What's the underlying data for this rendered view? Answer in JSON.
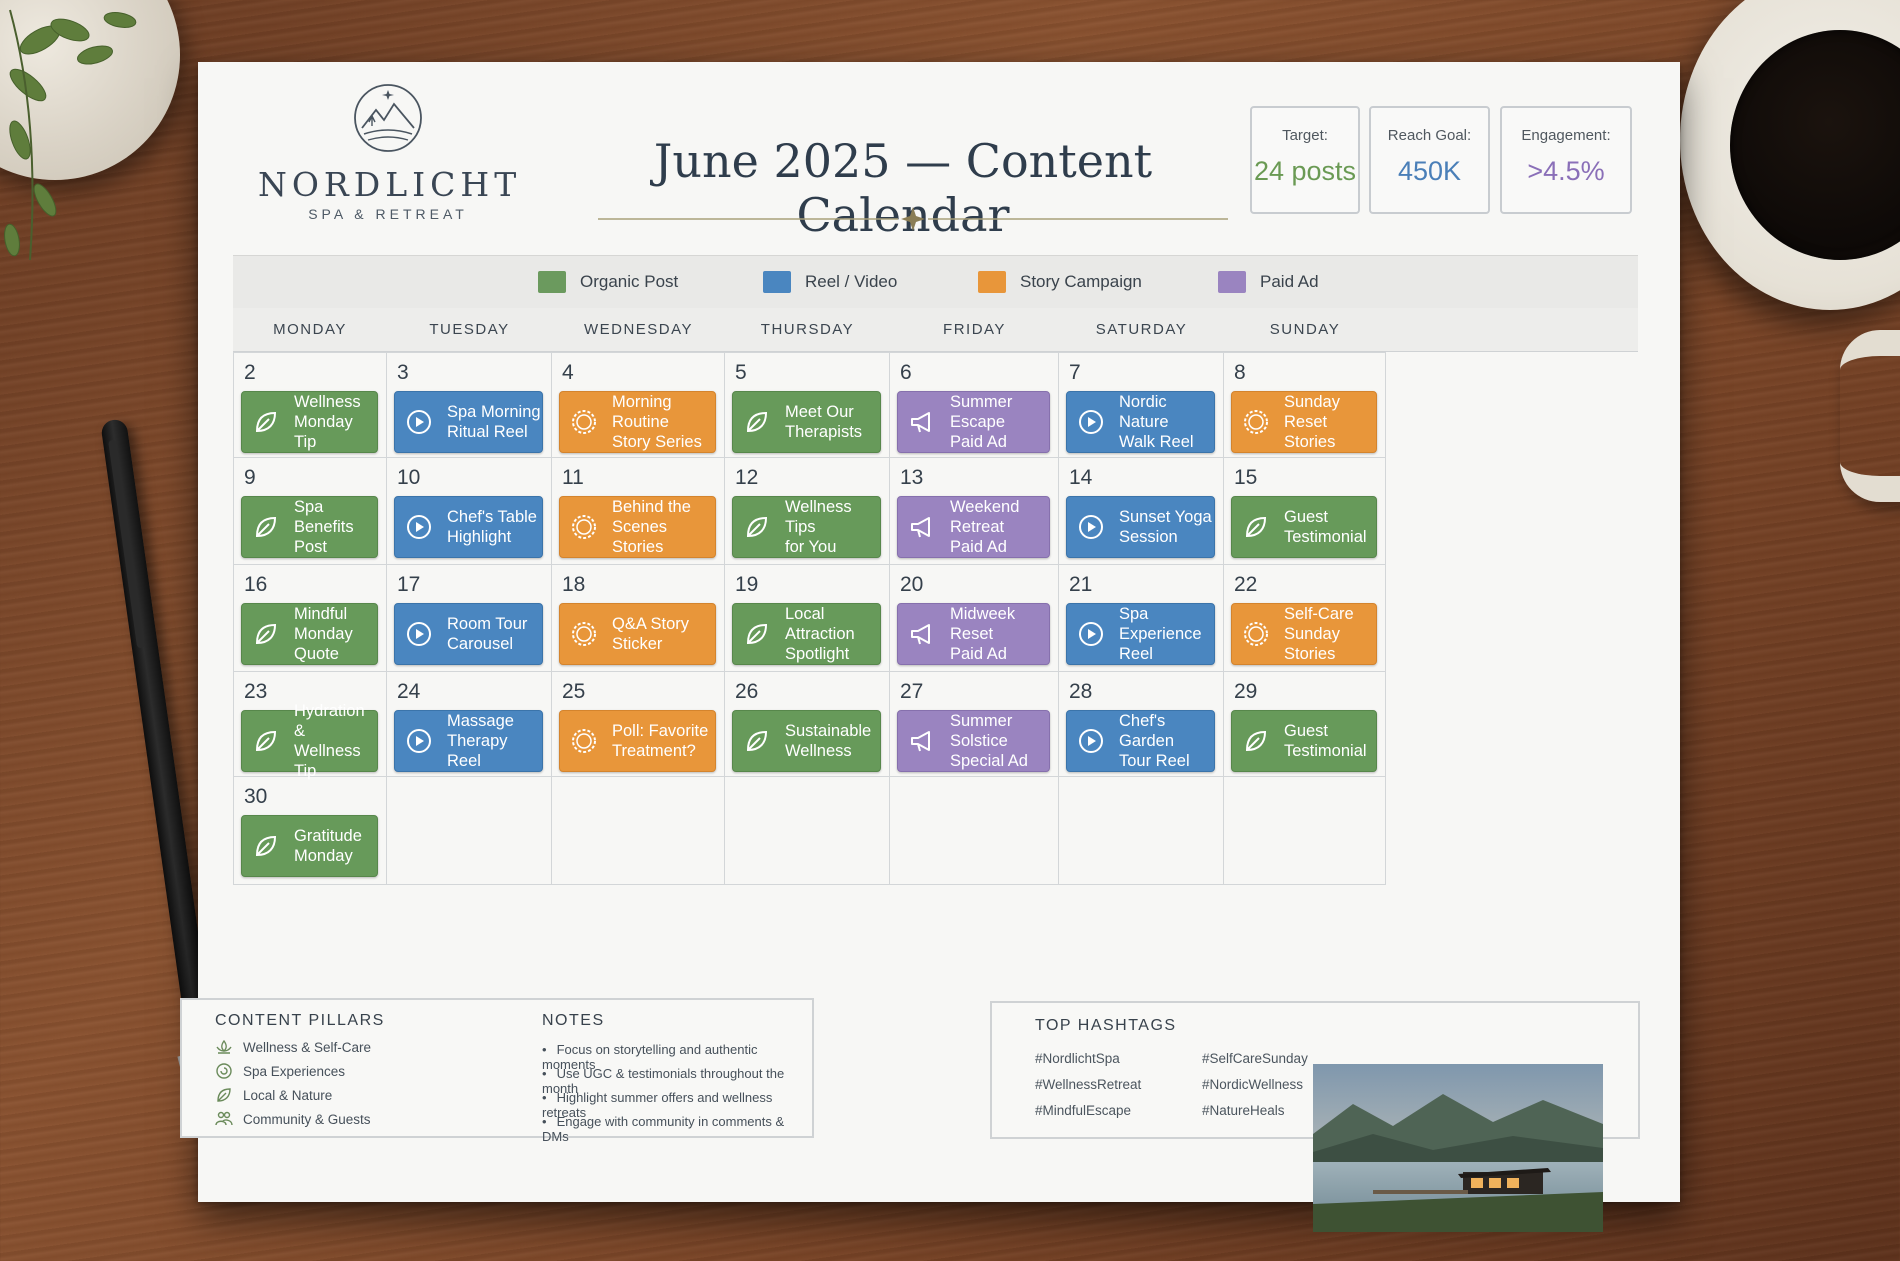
{
  "brand": {
    "name": "NORDLICHT",
    "tagline": "SPA & RETREAT"
  },
  "title": "June 2025 — Content Calendar",
  "stats": [
    {
      "label": "Target:",
      "value": "24 posts",
      "color": "#6a9a54"
    },
    {
      "label": "Reach Goal:",
      "value": "450K",
      "color": "#4a7fb8"
    },
    {
      "label": "Engagement:",
      "value": ">4.5%",
      "color": "#8a6fb8"
    }
  ],
  "legend": [
    {
      "label": "Organic Post",
      "color": "#6b9a5e"
    },
    {
      "label": "Reel / Video",
      "color": "#4a86c0"
    },
    {
      "label": "Story Campaign",
      "color": "#e8963a"
    },
    {
      "label": "Paid Ad",
      "color": "#9a84c0"
    }
  ],
  "days": [
    "MONDAY",
    "TUESDAY",
    "WEDNESDAY",
    "THURSDAY",
    "FRIDAY",
    "SATURDAY",
    "SUNDAY"
  ],
  "weeks": [
    [
      {
        "date": "2",
        "type": "organic",
        "icon": "leaf-icon",
        "label": [
          "Wellness",
          "Monday Tip"
        ]
      },
      {
        "date": "3",
        "type": "reel",
        "icon": "play-icon",
        "label": [
          "Spa Morning",
          "Ritual Reel"
        ]
      },
      {
        "date": "4",
        "type": "story",
        "icon": "circle-icon",
        "label": [
          "Morning Routine",
          "Story Series"
        ]
      },
      {
        "date": "5",
        "type": "organic",
        "icon": "leaf-icon",
        "label": [
          "Meet Our",
          "Therapists"
        ]
      },
      {
        "date": "6",
        "type": "paid",
        "icon": "megaphone-icon",
        "label": [
          "Summer Escape",
          "Paid Ad"
        ]
      },
      {
        "date": "7",
        "type": "reel",
        "icon": "play-icon",
        "label": [
          "Nordic Nature",
          "Walk Reel"
        ]
      },
      {
        "date": "8",
        "type": "story",
        "icon": "circle-icon",
        "label": [
          "Sunday Reset",
          "Stories"
        ]
      }
    ],
    [
      {
        "date": "9",
        "type": "organic",
        "icon": "leaf-icon",
        "label": [
          "Spa Benefits",
          "Post"
        ]
      },
      {
        "date": "10",
        "type": "reel",
        "icon": "play-icon",
        "label": [
          "Chef's Table",
          "Highlight"
        ]
      },
      {
        "date": "11",
        "type": "story",
        "icon": "circle-icon",
        "label": [
          "Behind the Scenes",
          "Stories"
        ]
      },
      {
        "date": "12",
        "type": "organic",
        "icon": "leaf-icon",
        "label": [
          "Wellness Tips",
          "for You"
        ]
      },
      {
        "date": "13",
        "type": "paid",
        "icon": "megaphone-icon",
        "label": [
          "Weekend Retreat",
          "Paid Ad"
        ]
      },
      {
        "date": "14",
        "type": "reel",
        "icon": "play-icon",
        "label": [
          "Sunset Yoga",
          "Session"
        ]
      },
      {
        "date": "15",
        "type": "organic",
        "icon": "leaf-icon",
        "label": [
          "Guest Testimonial",
          ""
        ]
      }
    ],
    [
      {
        "date": "16",
        "type": "organic",
        "icon": "leaf-icon",
        "label": [
          "Mindful Monday",
          "Quote"
        ]
      },
      {
        "date": "17",
        "type": "reel",
        "icon": "play-icon",
        "label": [
          "Room Tour",
          "Carousel"
        ]
      },
      {
        "date": "18",
        "type": "story",
        "icon": "circle-icon",
        "label": [
          "Q&A Story",
          "Sticker"
        ]
      },
      {
        "date": "19",
        "type": "organic",
        "icon": "leaf-icon",
        "label": [
          "Local Attraction",
          "Spotlight"
        ]
      },
      {
        "date": "20",
        "type": "paid",
        "icon": "megaphone-icon",
        "label": [
          "Midweek Reset",
          "Paid Ad"
        ]
      },
      {
        "date": "21",
        "type": "reel",
        "icon": "play-icon",
        "label": [
          "Spa Experience",
          "Reel"
        ]
      },
      {
        "date": "22",
        "type": "story",
        "icon": "circle-icon",
        "label": [
          "Self-Care Sunday",
          "Stories"
        ]
      }
    ],
    [
      {
        "date": "23",
        "type": "organic",
        "icon": "leaf-icon",
        "label": [
          "Hydration &",
          "Wellness Tip"
        ]
      },
      {
        "date": "24",
        "type": "reel",
        "icon": "play-icon",
        "label": [
          "Massage Therapy",
          "Reel"
        ]
      },
      {
        "date": "25",
        "type": "story",
        "icon": "circle-icon",
        "label": [
          "Poll: Favorite",
          "Treatment?"
        ]
      },
      {
        "date": "26",
        "type": "organic",
        "icon": "leaf-icon",
        "label": [
          "Sustainable",
          "Wellness"
        ]
      },
      {
        "date": "27",
        "type": "paid",
        "icon": "megaphone-icon",
        "label": [
          "Summer Solstice",
          "Special Ad"
        ]
      },
      {
        "date": "28",
        "type": "reel",
        "icon": "play-icon",
        "label": [
          "Chef's Garden",
          "Tour Reel"
        ]
      },
      {
        "date": "29",
        "type": "organic",
        "icon": "leaf-icon",
        "label": [
          "Guest Testimonial",
          ""
        ]
      }
    ],
    [
      {
        "date": "30",
        "type": "organic",
        "icon": "leaf-icon",
        "label": [
          "Gratitude",
          "Monday"
        ]
      }
    ]
  ],
  "pillars": {
    "title": "CONTENT PILLARS",
    "items": [
      {
        "label": "Wellness & Self-Care",
        "icon": "lotus-icon"
      },
      {
        "label": "Spa Experiences",
        "icon": "spiral-icon"
      },
      {
        "label": "Local & Nature",
        "icon": "leaf-icon"
      },
      {
        "label": "Community & Guests",
        "icon": "people-icon"
      }
    ]
  },
  "notes": {
    "title": "NOTES",
    "items": [
      "Focus on storytelling and authentic moments",
      "Use UGC & testimonials throughout the month",
      "Highlight summer offers and wellness retreats",
      "Engage with community in comments & DMs"
    ]
  },
  "hashtags": {
    "title": "TOP HASHTAGS",
    "items": [
      "#NordlichtSpa",
      "#SelfCareSunday",
      "#WellnessRetreat",
      "#NordicWellness",
      "#MindfulEscape",
      "#NatureHeals"
    ]
  }
}
